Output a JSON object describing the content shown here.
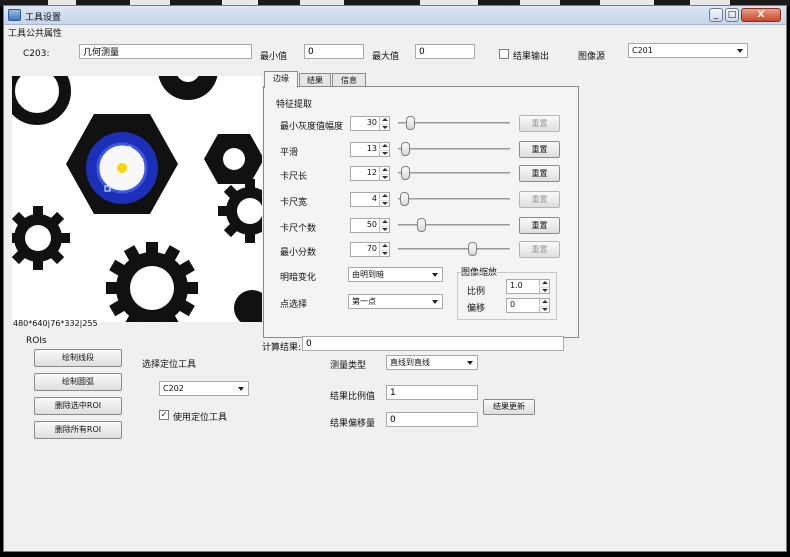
{
  "window": {
    "title": "工具设置"
  },
  "window_controls": {
    "minimize": "_",
    "maximize": "□",
    "close": "X"
  },
  "common": {
    "section": "工具公共属性",
    "tool_id": "C203:",
    "tool_name": "几何测量",
    "min_label": "最小值",
    "min_value": "0",
    "max_label": "最大值",
    "max_value": "0",
    "result_output_label": "结果输出",
    "image_source_label": "图像源",
    "image_source_value": "C201"
  },
  "image_info": "480*640|76*332|255",
  "tabs": [
    "边缘",
    "结果",
    "信息"
  ],
  "feature": {
    "title": "特征提取",
    "params": [
      {
        "label": "最小灰度值幅度",
        "value": "30",
        "pos": 0.08,
        "reset": "重置",
        "enabled": false
      },
      {
        "label": "平滑",
        "value": "13",
        "pos": 0.03,
        "reset": "重置",
        "enabled": true
      },
      {
        "label": "卡尺长",
        "value": "12",
        "pos": 0.03,
        "reset": "重置",
        "enabled": true
      },
      {
        "label": "卡尺宽",
        "value": "4",
        "pos": 0.02,
        "reset": "重置",
        "enabled": false
      },
      {
        "label": "卡尺个数",
        "value": "50",
        "pos": 0.18,
        "reset": "重置",
        "enabled": true
      },
      {
        "label": "最小分数",
        "value": "70",
        "pos": 0.68,
        "reset": "重置",
        "enabled": false
      }
    ],
    "transition_label": "明暗变化",
    "transition_value": "由明到暗",
    "point_label": "点选择",
    "point_value": "第一点",
    "image_scale_title": "图像缩放",
    "ratio_label": "比例",
    "ratio_value": "1.0",
    "offset_label": "偏移",
    "offset_value": "0"
  },
  "calc": {
    "label": "计算结果:",
    "value": "0"
  },
  "roi": {
    "title": "ROIs",
    "buttons": [
      "绘制线段",
      "绘制圆弧",
      "删除选中ROI",
      "删除所有ROI"
    ]
  },
  "locator": {
    "title": "选择定位工具",
    "value": "C202",
    "use_label": "使用定位工具",
    "use_checked": true
  },
  "measure": {
    "type_label": "测量类型",
    "type_value": "直线到直线",
    "scale_label": "结果比例值",
    "scale_value": "1",
    "offset_label": "结果偏移量",
    "offset_value": "0",
    "update_label": "结果更新"
  }
}
